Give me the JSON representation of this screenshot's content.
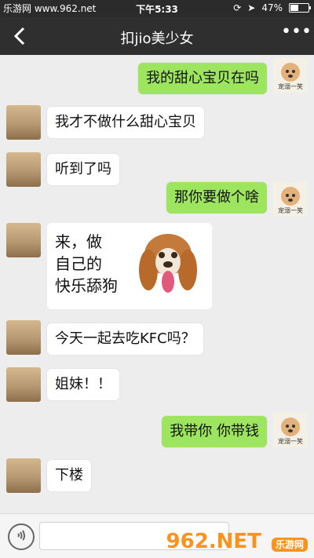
{
  "watermark": "乐游网 www.962.net",
  "status": {
    "time": "下午5:33",
    "battery": "47%",
    "battery_level": 0.47
  },
  "header": {
    "title": "扣jio美少女"
  },
  "messages": [
    {
      "side": "right",
      "text": "我的甜心宝贝在吗",
      "avatar_caption": "宠溺一笑"
    },
    {
      "side": "left",
      "text": "我才不做什么甜心宝贝"
    },
    {
      "side": "left",
      "text": "听到了吗"
    },
    {
      "side": "right",
      "text": "那你要做个啥",
      "avatar_caption": "宠溺一笑"
    },
    {
      "side": "left",
      "sticker_text": "来，做\n自己的\n快乐舔狗"
    },
    {
      "side": "left",
      "text": "今天一起去吃KFC吗？"
    },
    {
      "side": "left",
      "text": "姐妹！！"
    },
    {
      "side": "right",
      "text": "我带你 你带钱",
      "avatar_caption": "宠溺一笑"
    },
    {
      "side": "left",
      "text": "下楼"
    }
  ],
  "logo": {
    "main": "962.NET",
    "sub": "乐游网"
  },
  "icons": {
    "back": "chevron-left-icon",
    "more": "more-dots-icon",
    "voice": "voice-icon"
  }
}
